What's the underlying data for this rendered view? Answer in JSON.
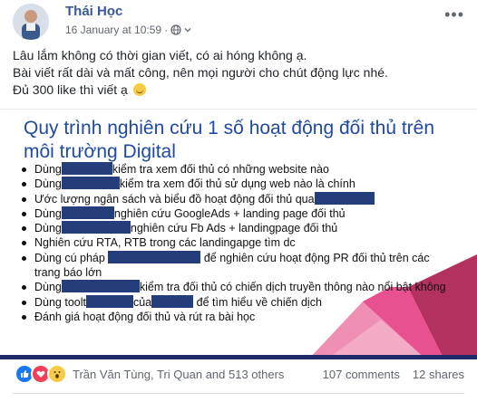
{
  "post": {
    "author": "Thái Học",
    "timestamp": "16 January at 10:59",
    "separator": "·",
    "privacy_icon": "globe-icon",
    "menu_icon": "more-dots-icon",
    "text_lines": [
      "Lâu lắm không có thời gian viết, có ai hóng không ạ.",
      "Bài viết rất dài và mất công, nên mọi người cho chút động lực nhé.",
      "Đủ 300 like thì viết ạ"
    ]
  },
  "slide": {
    "title": "Quy trình nghiên cứu 1 số hoạt động đối thủ trên môi trường Digital",
    "bullets": [
      {
        "before": "Dùng",
        "after": "kiểm tra xem đối thủ có những website nào"
      },
      {
        "before": "Dùng",
        "after": "kiểm tra xem đối thủ sử dụng web nào là chính"
      },
      {
        "before": "Ước lượng ngân sách và biểu đồ hoạt động đối thủ qua",
        "after": ""
      },
      {
        "before": "Dùng",
        "after": "nghiên cứu GoogleAds + landing page đối thủ"
      },
      {
        "before": "Dùng",
        "after": "nghiên cứu Fb Ads + landingpage đối thủ"
      },
      {
        "before": "Nghiên cứu RTA, RTB trong các landingapge tìm dc",
        "after": ""
      },
      {
        "before": "Dùng cú pháp",
        "after": "để nghiên cứu hoạt động PR đối thủ trên các trang báo lớn"
      },
      {
        "before": "Dùng",
        "after": "kiểm tra đối thủ có chiến dịch truyền thông nào nổi bật không"
      },
      {
        "before": "Dùng toolt",
        "middle": "của",
        "after": "để tìm hiểu về chiến dịch"
      },
      {
        "before": "Đánh giá hoạt động đối thủ và rút ra bài học",
        "after": ""
      }
    ],
    "accent_colors": [
      "#e8518f",
      "#f08fb4",
      "#b2315f",
      "#1f2a6b"
    ]
  },
  "footer": {
    "reaction_icons": [
      "like-icon",
      "love-icon",
      "wow-icon"
    ],
    "names": "Trần Văn Tùng, Tri Quan and 513 others",
    "comments": "107 comments",
    "shares": "12 shares"
  }
}
